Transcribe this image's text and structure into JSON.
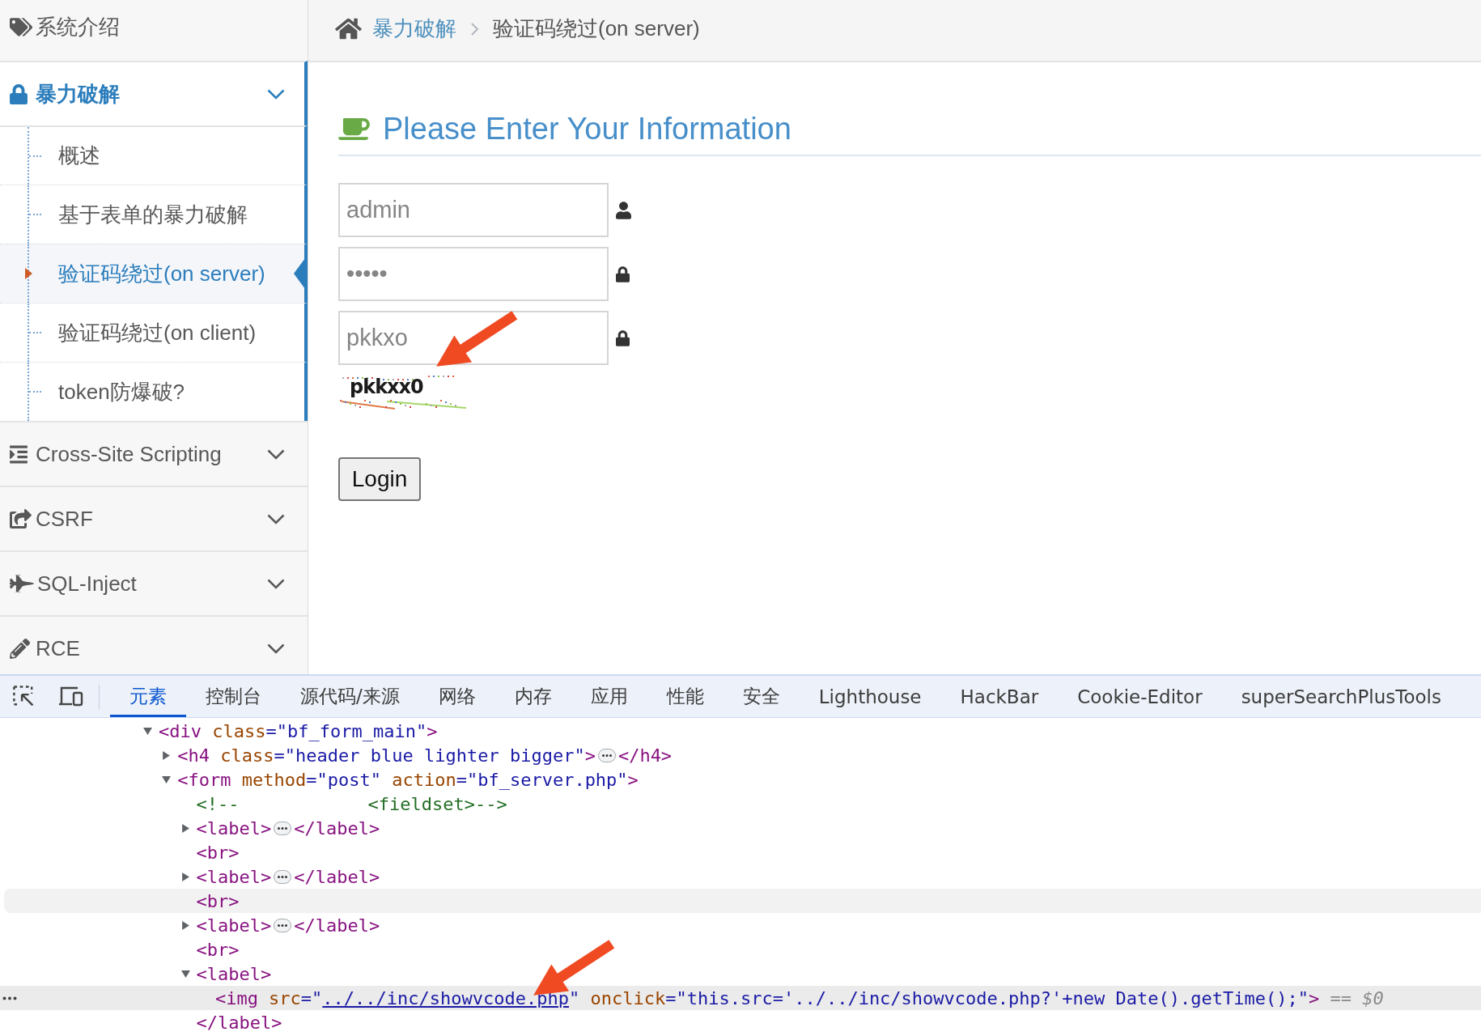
{
  "sidebar": {
    "items": [
      {
        "label": "系统介绍"
      },
      {
        "label": "暴力破解",
        "expanded": true,
        "children": [
          {
            "label": "概述",
            "selected": false
          },
          {
            "label": "基于表单的暴力破解",
            "selected": false
          },
          {
            "label": "验证码绕过(on server)",
            "selected": true
          },
          {
            "label": "验证码绕过(on client)",
            "selected": false
          },
          {
            "label": "token防爆破?",
            "selected": false
          }
        ]
      },
      {
        "label": "Cross-Site Scripting",
        "expanded": false
      },
      {
        "label": "CSRF",
        "expanded": false
      },
      {
        "label": "SQL-Inject",
        "expanded": false
      },
      {
        "label": "RCE",
        "expanded": false
      }
    ]
  },
  "breadcrumb": {
    "items": [
      {
        "label": "暴力破解",
        "kind": "link"
      },
      {
        "label": "验证码绕过(on server)",
        "kind": "current"
      }
    ]
  },
  "form": {
    "title": "Please Enter Your Information",
    "fields": [
      {
        "value": "admin"
      },
      {
        "value": "•••••"
      },
      {
        "value": "pkkxo"
      }
    ],
    "captcha": {
      "text": "pkkxx0"
    },
    "button": "Login"
  },
  "devtools": {
    "tabs": [
      {
        "label": "元素",
        "selected": true
      },
      {
        "label": "控制台",
        "selected": false
      },
      {
        "label": "源代码/来源",
        "selected": false
      },
      {
        "label": "网络",
        "selected": false
      },
      {
        "label": "内存",
        "selected": false
      },
      {
        "label": "应用",
        "selected": false
      },
      {
        "label": "性能",
        "selected": false
      },
      {
        "label": "安全",
        "selected": false
      },
      {
        "label": "Lighthouse",
        "selected": false
      },
      {
        "label": "HackBar",
        "selected": false
      },
      {
        "label": "Cookie-Editor",
        "selected": false
      },
      {
        "label": "superSearchPlusTools",
        "selected": false
      }
    ],
    "dom_tree": [
      {
        "tokens": [
          {
            "kind": "tag",
            "text": "<div"
          },
          {
            "kind": "attr",
            "text": " class"
          },
          {
            "kind": "value",
            "text": "=\"bf_form_main\""
          },
          {
            "kind": "tag",
            "text": ">"
          }
        ],
        "expanded": true,
        "selected": false,
        "hovered": false,
        "children": [
          {
            "tokens": [
              {
                "kind": "tag",
                "text": "<h4"
              },
              {
                "kind": "attr",
                "text": " class"
              },
              {
                "kind": "value",
                "text": "=\"header blue lighter bigger\""
              },
              {
                "kind": "tag",
                "text": ">"
              },
              {
                "kind": "ellipsis"
              },
              {
                "kind": "tag",
                "text": "</h4>"
              }
            ],
            "expanded": false,
            "selected": false,
            "hovered": false
          },
          {
            "tokens": [
              {
                "kind": "tag",
                "text": "<form"
              },
              {
                "kind": "attr",
                "text": " method"
              },
              {
                "kind": "value",
                "text": "=\"post\""
              },
              {
                "kind": "attr",
                "text": " action"
              },
              {
                "kind": "value",
                "text": "=\"bf_server.php\""
              },
              {
                "kind": "tag",
                "text": ">"
              }
            ],
            "expanded": true,
            "selected": false,
            "hovered": false,
            "children": [
              {
                "tokens": [
                  {
                    "kind": "comment",
                    "text": "<!--            <fieldset>-->"
                  }
                ],
                "selected": false,
                "hovered": false
              },
              {
                "tokens": [
                  {
                    "kind": "tag",
                    "text": "<label>"
                  },
                  {
                    "kind": "ellipsis"
                  },
                  {
                    "kind": "tag",
                    "text": "</label>"
                  }
                ],
                "expanded": false,
                "selected": false,
                "hovered": false
              },
              {
                "tokens": [
                  {
                    "kind": "tag",
                    "text": "<br>"
                  }
                ],
                "selected": false,
                "hovered": false
              },
              {
                "tokens": [
                  {
                    "kind": "tag",
                    "text": "<label>"
                  },
                  {
                    "kind": "ellipsis"
                  },
                  {
                    "kind": "tag",
                    "text": "</label>"
                  }
                ],
                "expanded": false,
                "selected": false,
                "hovered": false
              },
              {
                "tokens": [
                  {
                    "kind": "tag",
                    "text": "<br>"
                  }
                ],
                "selected": false,
                "hovered": true
              },
              {
                "tokens": [
                  {
                    "kind": "tag",
                    "text": "<label>"
                  },
                  {
                    "kind": "ellipsis"
                  },
                  {
                    "kind": "tag",
                    "text": "</label>"
                  }
                ],
                "expanded": false,
                "selected": false,
                "hovered": false
              },
              {
                "tokens": [
                  {
                    "kind": "tag",
                    "text": "<br>"
                  }
                ],
                "selected": false,
                "hovered": false
              },
              {
                "tokens": [
                  {
                    "kind": "tag",
                    "text": "<label>"
                  }
                ],
                "expanded": true,
                "selected": false,
                "hovered": false,
                "children": [
                  {
                    "tokens": [
                      {
                        "kind": "tag",
                        "text": "<img"
                      },
                      {
                        "kind": "attr",
                        "text": " src"
                      },
                      {
                        "kind": "value",
                        "text": "=\""
                      },
                      {
                        "kind": "link",
                        "text": "../../inc/showvcode.php"
                      },
                      {
                        "kind": "value",
                        "text": "\""
                      },
                      {
                        "kind": "attr",
                        "text": " onclick"
                      },
                      {
                        "kind": "value",
                        "text": "=\"this.src='../../inc/showvcode.php?'+new Date().getTime();\""
                      },
                      {
                        "kind": "tag",
                        "text": ">"
                      },
                      {
                        "kind": "eq",
                        "text": " == "
                      },
                      {
                        "kind": "ref",
                        "text": "$0"
                      }
                    ],
                    "selected": true,
                    "hovered": false
                  }
                ],
                "closing": [
                  {
                    "kind": "tag",
                    "text": "</label>"
                  }
                ]
              }
            ]
          }
        ]
      }
    ]
  }
}
